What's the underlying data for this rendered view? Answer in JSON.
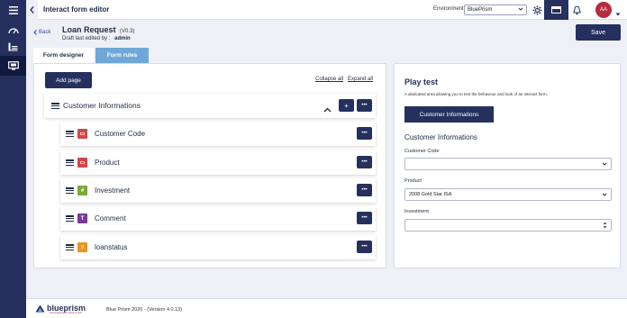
{
  "app": {
    "title": "Interact form editor"
  },
  "topbar": {
    "environment_label": "Environment:",
    "environment_value": "BluePrism",
    "avatar_initials": "AA"
  },
  "header": {
    "back_label": "Back",
    "form_title": "Loan Request",
    "form_version": "(V0.3)",
    "draft_prefix": "Draft last edited by :",
    "draft_user": "admin",
    "save_label": "Save"
  },
  "tabs": {
    "designer": "Form designer",
    "rules": "Form rules"
  },
  "designer": {
    "add_page_label": "Add page",
    "collapse_all": "Collapse all",
    "expand_all": "Expand all",
    "section_title": "Customer Informations",
    "add_symbol": "+",
    "more_symbol": "•••",
    "fields": [
      {
        "label": "Customer Code",
        "icon": "text-field-icon",
        "color": "#d04848",
        "glyph": "▭"
      },
      {
        "label": "Product",
        "icon": "dropdown-field-icon",
        "color": "#d04848",
        "glyph": "▭"
      },
      {
        "label": "Investment",
        "icon": "number-field-icon",
        "color": "#7aaa3a",
        "glyph": "#"
      },
      {
        "label": "Comment",
        "icon": "text-area-icon",
        "color": "#7a3a9a",
        "glyph": "T"
      },
      {
        "label": "loanstatus",
        "icon": "list-field-icon",
        "color": "#e8962a",
        "glyph": "≡"
      }
    ]
  },
  "playtest": {
    "title": "Play test",
    "description": "A dedicated area allowing you to test the behaviour and look of an interact form.",
    "section_button": "Customer Informations",
    "section_heading": "Customer Informations",
    "customer_code_label": "Customer Code",
    "customer_code_value": "",
    "product_label": "Product",
    "product_value": "2008 Gold Star ISA",
    "investment_label": "Investment",
    "investment_value": ""
  },
  "footer": {
    "logo_text": "blueprism",
    "logo_tagline": "Supercharging the world of work",
    "version_text": "Blue Prism 2020 - (Version 4.0.13)"
  },
  "colors": {
    "navy": "#25305e",
    "tab_blue": "#6fa8d8",
    "accent_red": "#b52d3d"
  }
}
